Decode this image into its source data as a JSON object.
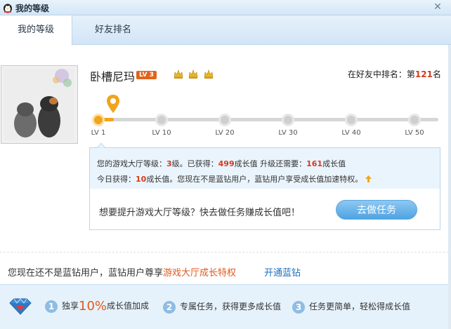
{
  "window": {
    "title": "我的等级",
    "close_glyph": "✕"
  },
  "tabs": [
    {
      "label": "我的等级",
      "active": true
    },
    {
      "label": "好友排名",
      "active": false
    }
  ],
  "profile": {
    "name": "卧槽尼玛",
    "level_badge": "LV 3",
    "crown_icons": [
      "crown-icon",
      "crown-icon",
      "crown-icon"
    ]
  },
  "rank": {
    "prefix": "在好友中排名：第",
    "value": "121",
    "suffix": "名"
  },
  "progress": {
    "current_fraction": 0.02,
    "levels": [
      "LV 1",
      "LV 10",
      "LV 20",
      "LV 30",
      "LV 40",
      "LV 50"
    ]
  },
  "info": {
    "l1_a": "您的游戏大厅等级：",
    "level": "3",
    "l1_b": "级。已获得：",
    "gained": "499",
    "l1_c": "成长值   升级还需要：",
    "needed": "161",
    "l1_d": "成长值",
    "l2_a": "今日获得：",
    "today": "10",
    "l2_b": "成长值。您现在不是蓝钻用户，蓝钻用户享受成长值加速特权。",
    "question": "想要提升游戏大厅等级？快去做任务赚成长值吧！",
    "task_button": "去做任务"
  },
  "notice": {
    "text": "您现在还不是蓝钻用户，蓝钻用户尊享",
    "privilege": "游戏大厅成长特权",
    "open_link": "开通蓝钻"
  },
  "benefits": [
    {
      "num": "1",
      "pre": "独享",
      "big": "10%",
      "post": "成长值加成"
    },
    {
      "num": "2",
      "text": "专属任务，获得更多成长值"
    },
    {
      "num": "3",
      "text": "任务更简单，轻松得成长值"
    }
  ],
  "colors": {
    "accent_orange": "#f0a51e",
    "highlight_red": "#d43b1e",
    "link_blue": "#1d6fc0",
    "button_blue": "#4ea3e3"
  }
}
